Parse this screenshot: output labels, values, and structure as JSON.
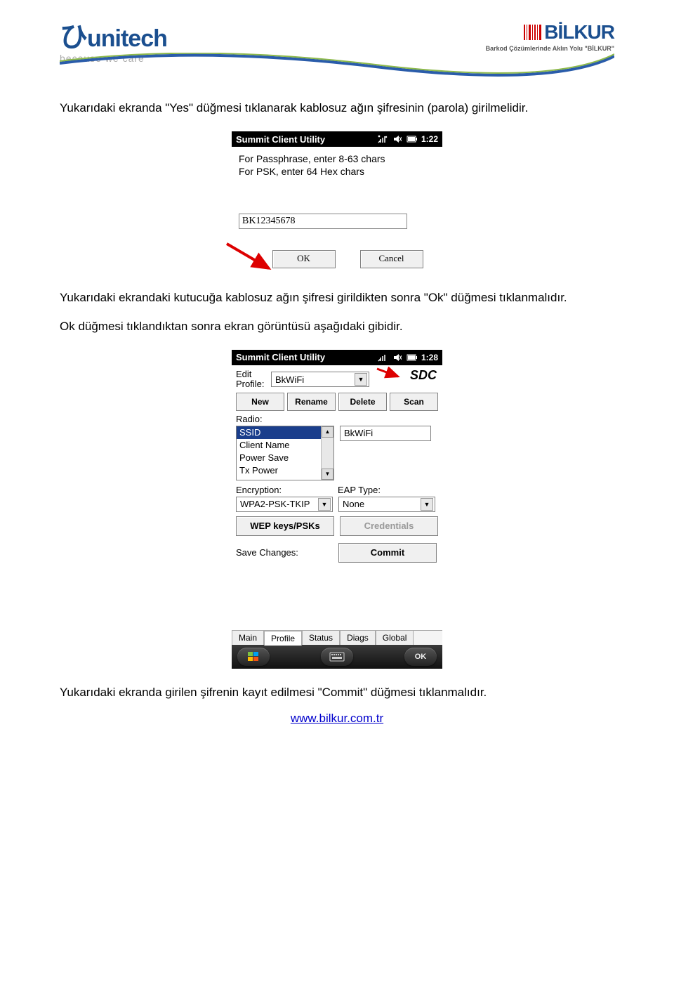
{
  "header": {
    "left_logo": {
      "name": "unitech",
      "tagline": "because we care"
    },
    "right_logo": {
      "name": "BİLKUR",
      "tagline": "Barkod Çözümlerinde Aklın Yolu \"BİLKUR\""
    }
  },
  "para1": "Yukarıdaki ekranda \"Yes\" düğmesi tıklanarak kablosuz ağın şifresinin (parola) girilmelidir.",
  "screenshot1": {
    "title": "Summit Client Utility",
    "time": "1:22",
    "hint_line1": "For Passphrase, enter 8-63 chars",
    "hint_line2": "For PSK, enter 64 Hex chars",
    "input_value": "BK12345678",
    "ok_label": "OK",
    "cancel_label": "Cancel"
  },
  "para2": "Yukarıdaki ekrandaki kutucuğa kablosuz ağın şifresi girildikten sonra \"Ok\" düğmesi tıklanmalıdır.",
  "para3": "Ok düğmesi tıklandıktan sonra ekran görüntüsü aşağıdaki gibidir.",
  "screenshot2": {
    "title": "Summit Client Utility",
    "time": "1:28",
    "edit_profile_label": "Edit\nProfile:",
    "edit_profile_label_line1": "Edit",
    "edit_profile_label_line2": "Profile:",
    "profile_value": "BkWiFi",
    "sdc_label": "SDC",
    "buttons": {
      "new": "New",
      "rename": "Rename",
      "delete": "Delete",
      "scan": "Scan"
    },
    "radio_label": "Radio:",
    "radio_items": [
      "SSID",
      "Client Name",
      "Power Save",
      "Tx Power"
    ],
    "radio_selected": "SSID",
    "radio_value": "BkWiFi",
    "encryption_label": "Encryption:",
    "encryption_value": "WPA2-PSK-TKIP",
    "eap_label": "EAP Type:",
    "eap_value": "None",
    "wep_btn": "WEP keys/PSKs",
    "cred_btn": "Credentials",
    "save_label": "Save Changes:",
    "commit_btn": "Commit",
    "tabs": [
      "Main",
      "Profile",
      "Status",
      "Diags",
      "Global"
    ],
    "active_tab": "Profile",
    "bottom_ok": "OK"
  },
  "para4": "Yukarıdaki ekranda girilen şifrenin kayıt edilmesi \"Commit\" düğmesi tıklanmalıdır.",
  "footer_url": "www.bilkur.com.tr"
}
